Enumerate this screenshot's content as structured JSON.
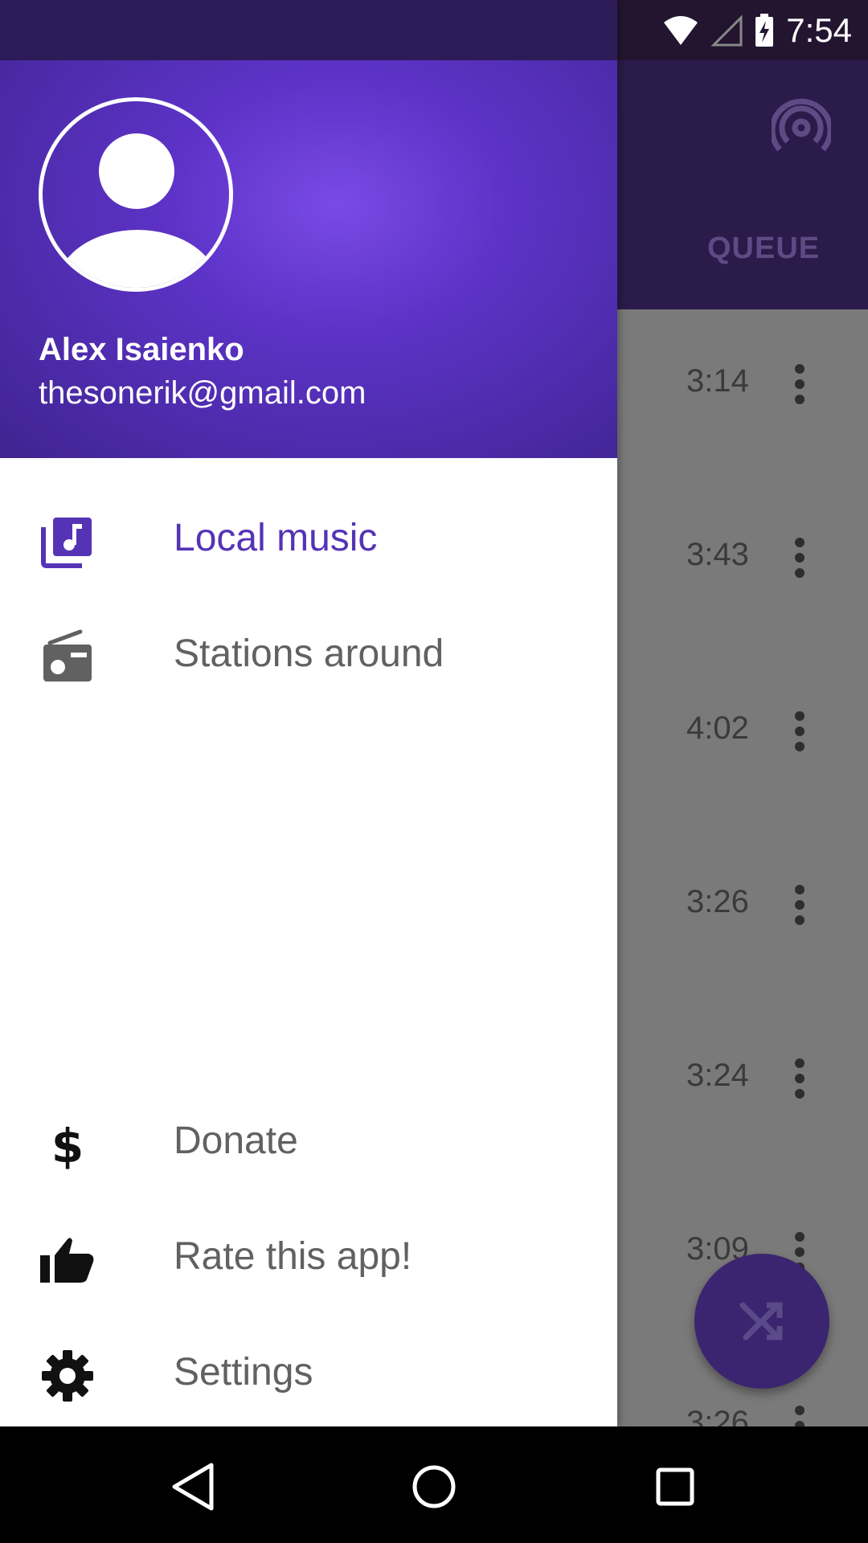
{
  "status_bar": {
    "time": "7:54"
  },
  "app": {
    "tab_label": "QUEUE",
    "durations": [
      "3:14",
      "3:43",
      "4:02",
      "3:26",
      "3:24",
      "3:09",
      "3:26"
    ],
    "fab_icon": "shuffle-icon",
    "cast_icon": "podcast-icon"
  },
  "drawer": {
    "user": {
      "name": "Alex Isaienko",
      "email": "thesonerik@gmail.com"
    },
    "items": [
      {
        "label": "Local music",
        "icon": "library-music-icon",
        "active": true
      },
      {
        "label": "Stations around",
        "icon": "radio-icon",
        "active": false
      }
    ],
    "footer_items": [
      {
        "label": "Donate",
        "icon": "dollar-icon"
      },
      {
        "label": "Rate this app!",
        "icon": "thumb-up-icon"
      },
      {
        "label": "Settings",
        "icon": "gear-icon"
      }
    ],
    "accent_color": "#5533b5"
  },
  "system_nav": {
    "back": "back-icon",
    "home": "home-icon",
    "recents": "recents-icon"
  }
}
